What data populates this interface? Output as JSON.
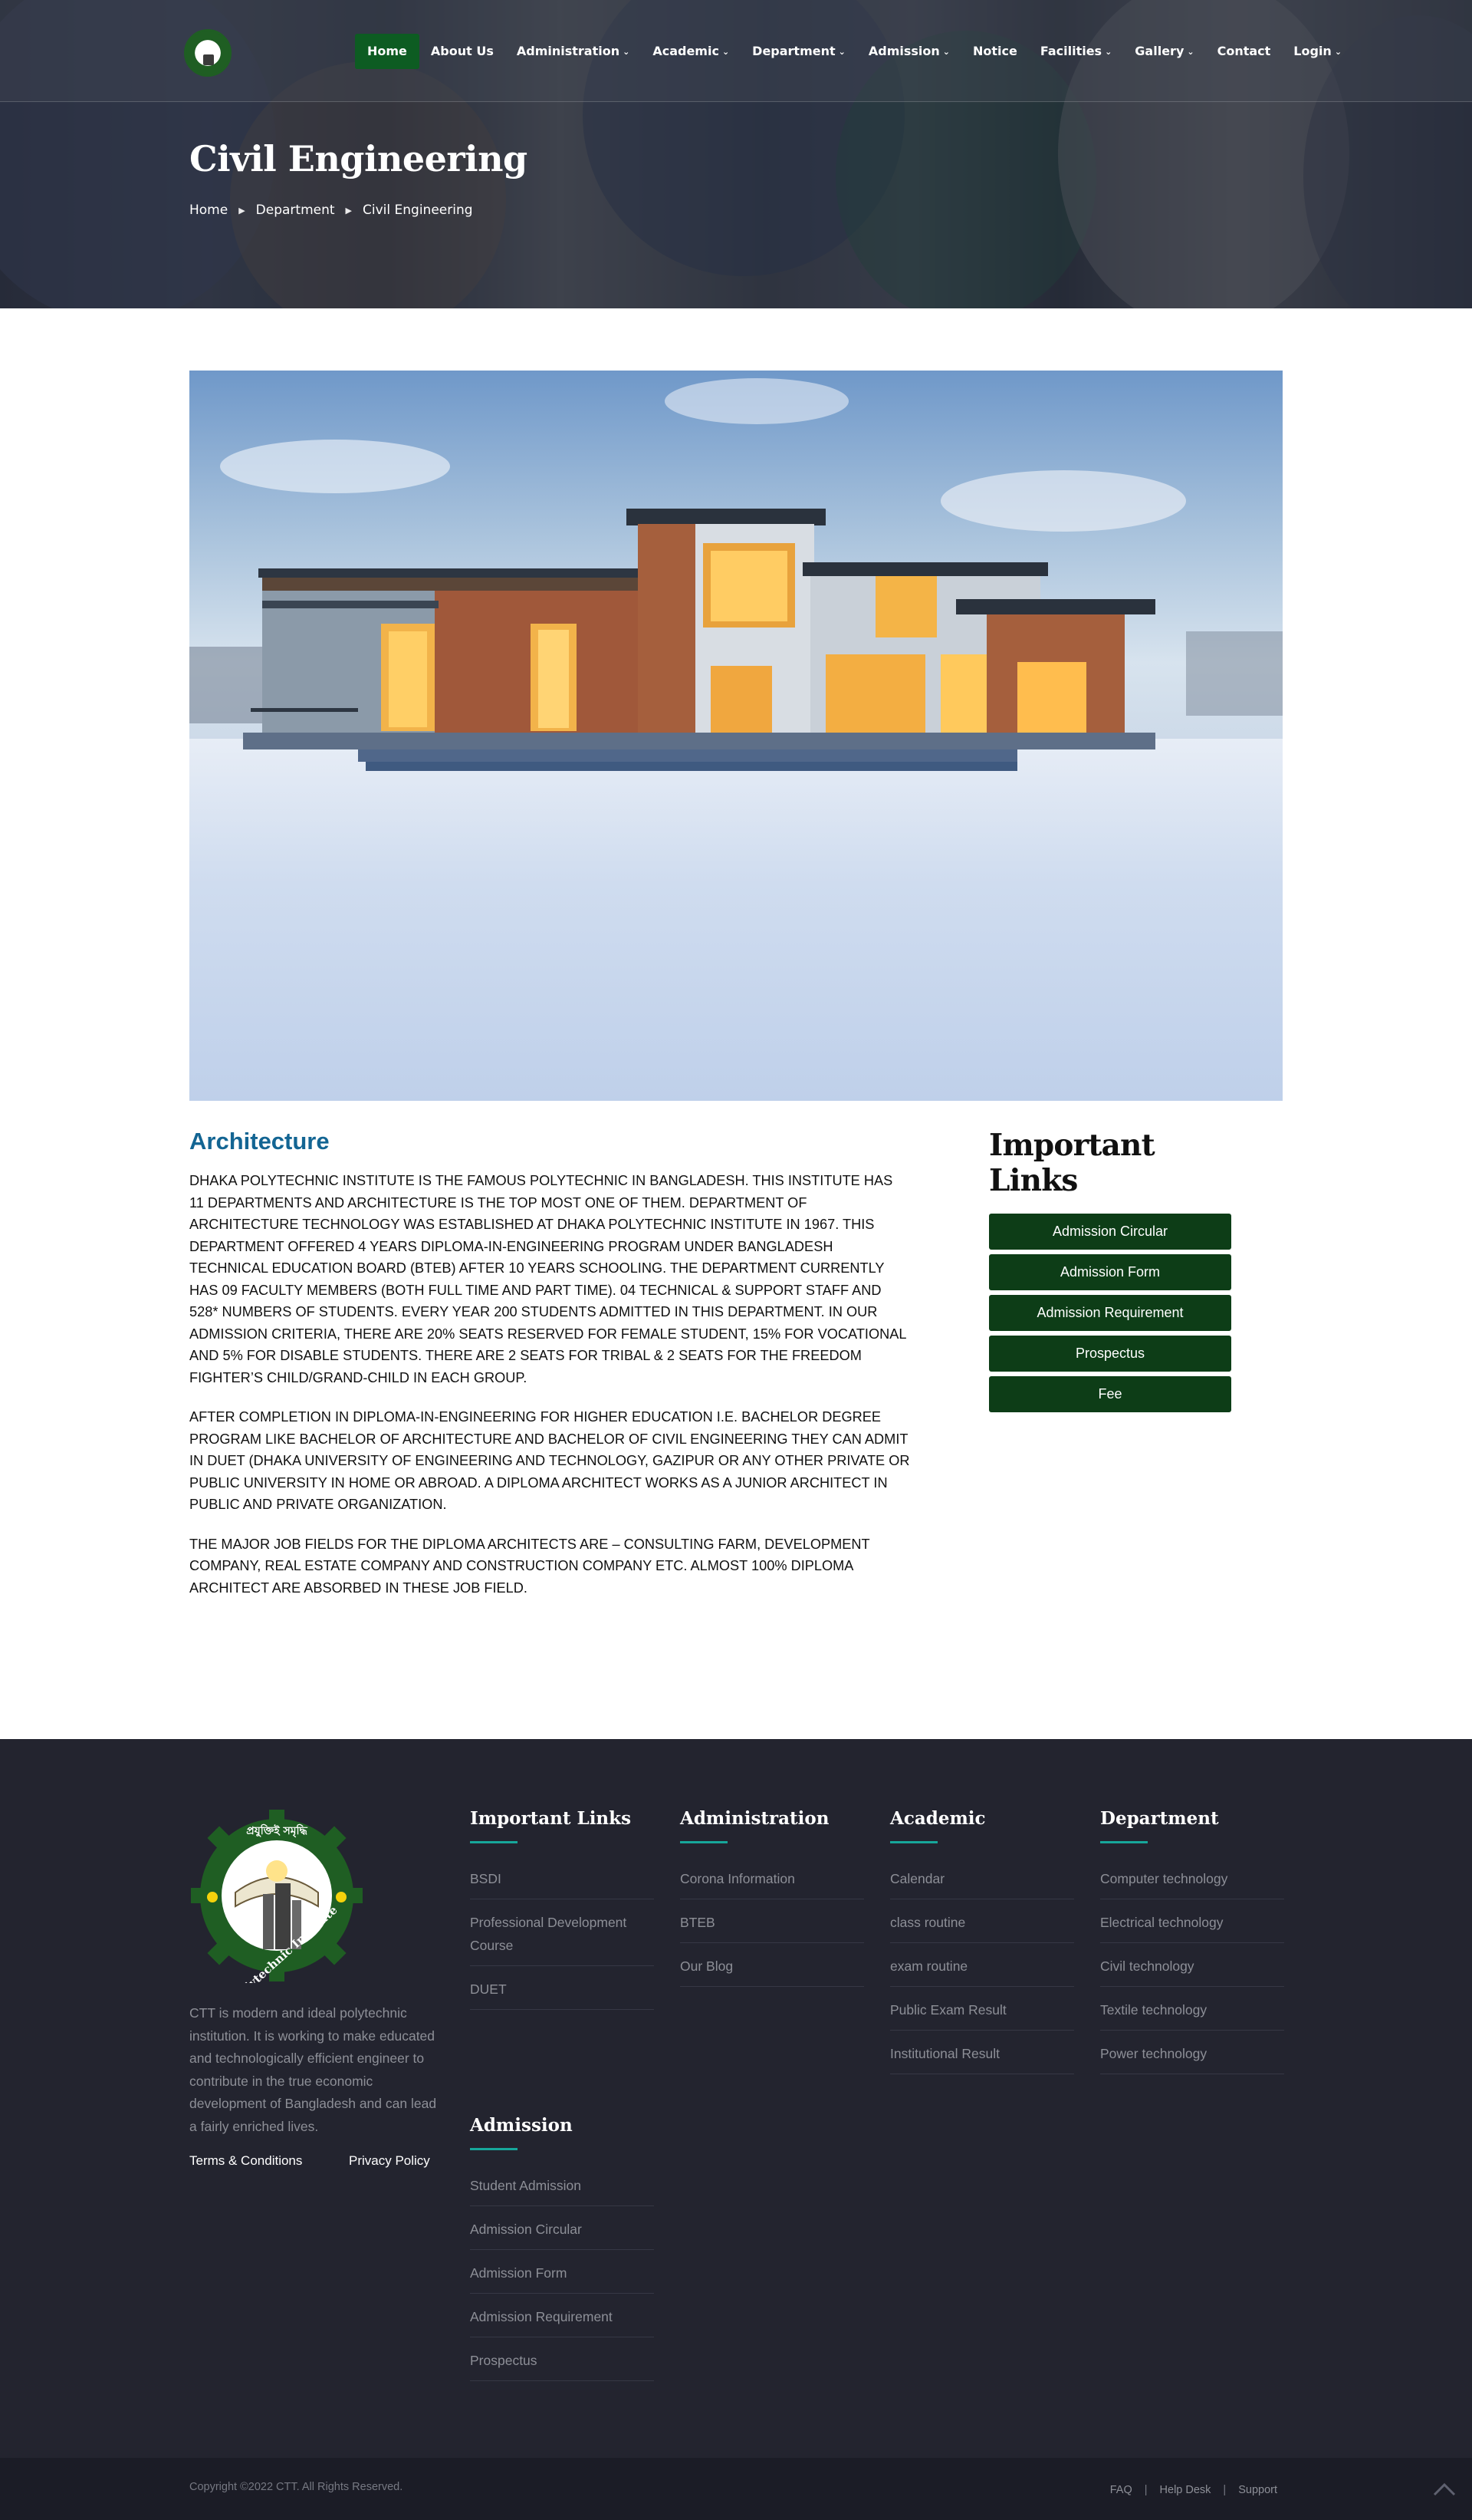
{
  "header": {
    "nav": [
      {
        "label": "Home",
        "active": true,
        "dropdown": false
      },
      {
        "label": "About Us",
        "dropdown": false
      },
      {
        "label": "Administration",
        "dropdown": true
      },
      {
        "label": "Academic",
        "dropdown": true
      },
      {
        "label": "Department",
        "dropdown": true
      },
      {
        "label": "Admission",
        "dropdown": true
      },
      {
        "label": "Notice",
        "dropdown": false
      },
      {
        "label": "Facilities",
        "dropdown": true
      },
      {
        "label": "Gallery",
        "dropdown": true
      },
      {
        "label": "Contact",
        "dropdown": false
      },
      {
        "label": "Login",
        "dropdown": true
      }
    ],
    "page_title": "Civil Engineering",
    "breadcrumb": [
      "Home",
      "Department",
      "Civil Engineering"
    ]
  },
  "main": {
    "heading": "Architecture",
    "paragraphs": [
      "DHAKA POLYTECHNIC INSTITUTE IS THE FAMOUS POLYTECHNIC IN BANGLADESH. THIS INSTITUTE HAS 11 DEPARTMENTS AND ARCHITECTURE IS THE TOP MOST ONE OF THEM. DEPARTMENT OF ARCHITECTURE TECHNOLOGY WAS ESTABLISHED AT DHAKA POLYTECHNIC INSTITUTE IN 1967. THIS DEPARTMENT OFFERED 4 YEARS DIPLOMA-IN-ENGINEERING PROGRAM UNDER BANGLADESH TECHNICAL EDUCATION BOARD (BTEB) AFTER 10 YEARS SCHOOLING. THE DEPARTMENT CURRENTLY HAS   09 FACULTY MEMBERS (BOTH FULL TIME AND PART TIME). 04 TECHNICAL & SUPPORT STAFF AND 528* NUMBERS OF STUDENTS. EVERY YEAR 200 STUDENTS ADMITTED IN THIS DEPARTMENT. IN OUR ADMISSION CRITERIA, THERE ARE 20% SEATS RESERVED FOR FEMALE STUDENT, 15% FOR VOCATIONAL AND 5% FOR DISABLE STUDENTS. THERE ARE 2 SEATS FOR TRIBAL & 2 SEATS FOR THE FREEDOM FIGHTER’S CHILD/GRAND-CHILD IN EACH GROUP.",
      "AFTER COMPLETION IN DIPLOMA-IN-ENGINEERING FOR HIGHER EDUCATION I.E. BACHELOR DEGREE PROGRAM LIKE BACHELOR OF ARCHITECTURE AND BACHELOR OF CIVIL ENGINEERING THEY CAN ADMIT IN DUET (DHAKA UNIVERSITY OF ENGINEERING AND TECHNOLOGY, GAZIPUR OR ANY OTHER PRIVATE OR PUBLIC UNIVERSITY IN HOME OR ABROAD. A DIPLOMA ARCHITECT WORKS AS A JUNIOR ARCHITECT IN PUBLIC AND PRIVATE ORGANIZATION.",
      "THE MAJOR JOB FIELDS FOR THE DIPLOMA ARCHITECTS ARE – CONSULTING FARM, DEVELOPMENT COMPANY, REAL ESTATE COMPANY AND CONSTRUCTION COMPANY ETC. ALMOST 100% DIPLOMA ARCHITECT ARE ABSORBED IN THESE JOB FIELD."
    ]
  },
  "sidebar": {
    "title": "Important Links",
    "buttons": [
      "Admission Circular",
      "Admission Form",
      "Admission Requirement",
      "Prospectus",
      "Fee"
    ]
  },
  "footer": {
    "logo_text": [
      "প্রযুক্তিই সমৃদ্ধি",
      "CTT Polytechnic Institute"
    ],
    "about": "CTT is modern and ideal polytechnic institution. It is working to make educated and technologically efficient engineer to contribute in the true economic development of Bangladesh and can lead a fairly enriched lives.",
    "legal": [
      "Terms & Conditions",
      "Privacy Policy"
    ],
    "columns": [
      {
        "title": "Important Links",
        "links": [
          "BSDI",
          "Professional Development Course",
          "DUET"
        ]
      },
      {
        "title": "Administration",
        "links": [
          "Corona Information",
          "BTEB",
          "Our Blog"
        ]
      },
      {
        "title": "Academic",
        "links": [
          "Calendar",
          "class routine",
          "exam routine",
          "Public Exam Result",
          "Institutional Result"
        ]
      },
      {
        "title": "Department",
        "links": [
          "Computer technology",
          "Electrical technology",
          "Civil technology",
          "Textile technology",
          "Power technology"
        ]
      },
      {
        "title": "Admission",
        "links": [
          "Student Admission",
          "Admission Circular",
          "Admission Form",
          "Admission Requirement",
          "Prospectus"
        ]
      }
    ],
    "copyright": "Copyright ©2022 CTT. All Rights Reserved.",
    "bottom_links": [
      "FAQ",
      "Help Desk",
      "Support"
    ]
  },
  "colors": {
    "nav_active": "#0d5c22",
    "heading_blue": "#136593",
    "sidebar_button": "#0d3d17",
    "footer_bg": "#23242f",
    "footer_accent": "#17a79b"
  },
  "icons": [
    "caret-down-icon",
    "breadcrumb-arrow-icon",
    "back-to-top-chevron-icon"
  ]
}
